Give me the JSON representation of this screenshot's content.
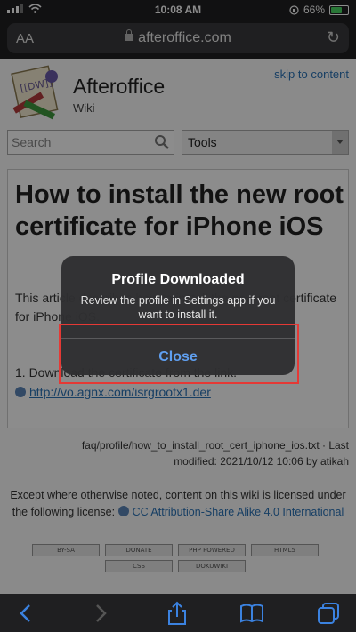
{
  "status": {
    "time": "10:08 AM",
    "battery_pct": "66%",
    "battery_level": 0.66
  },
  "browser": {
    "text_size_label": "AA",
    "url": "afteroffice.com"
  },
  "site": {
    "title": "Afteroffice",
    "subtitle": "Wiki",
    "skip_link": "skip to content"
  },
  "search": {
    "placeholder": "Search"
  },
  "tools": {
    "label": "Tools"
  },
  "article": {
    "title": "How to install the new root certificate for iPhone iOS",
    "intro": "This article describes how to install the new root certificate for iPhone iOS.",
    "step1": "1. Download the certificate from the link.",
    "cert_link": "http://vo.agnx.com/isrgrootx1.der"
  },
  "meta": {
    "path": "faq/profile/how_to_install_root_cert_iphone_ios.txt · Last",
    "modified": "modified: 2021/10/12 10:06 by atikah"
  },
  "license": {
    "text": "Except where otherwise noted, content on this wiki is licensed under the following license:",
    "link": "CC Attribution-Share Alike 4.0 International"
  },
  "badges": [
    "BY-SA",
    "DONATE",
    "PHP POWERED",
    "HTML5",
    "CSS",
    "DOKUWIKI"
  ],
  "alert": {
    "title": "Profile Downloaded",
    "message": "Review the profile in Settings app if you want to install it.",
    "button": "Close"
  },
  "colors": {
    "accent": "#5f9ff0",
    "highlight": "#e53935",
    "link": "#2b73b7"
  }
}
